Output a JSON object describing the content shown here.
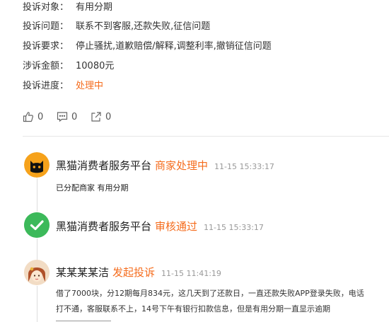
{
  "info": {
    "target_label": "投诉对象：",
    "target_value": "有用分期",
    "issue_label": "投诉问题：",
    "issue_value": "联系不到客服,还款失败,征信问题",
    "demand_label": "投诉要求：",
    "demand_value": "停止骚扰,道歉赔偿/解释,调整利率,撤销征信问题",
    "amount_label": "涉诉金额：",
    "amount_value": "10080元",
    "progress_label": "投诉进度：",
    "progress_value": "处理中"
  },
  "actions": {
    "like_count": "0",
    "comment_count": "0",
    "share_count": "0"
  },
  "timeline": [
    {
      "name": "黑猫消费者服务平台",
      "status": "商家处理中",
      "time": "11-15 15:33:17",
      "desc": "已分配商家 有用分期",
      "icon": "black-cat-logo"
    },
    {
      "name": "黑猫消费者服务平台",
      "status": "审核通过",
      "time": "11-15 15:33:17",
      "icon": "check-icon"
    },
    {
      "name": "某某某某洁",
      "status": "发起投诉",
      "time": "11-15 11:41:19",
      "body": "借了7000块，分12期每月834元，这几天到了还款日，一直还款失败APP登录失败，电话打不通，客服联系不上，14号下午有银行扣款信息，但是有用分期一直显示逾期",
      "icon": "user-avatar"
    }
  ],
  "colors": {
    "accent_orange": "#f56c1d",
    "check_green": "#3cb95a",
    "timeline_line": "#dddddd"
  }
}
